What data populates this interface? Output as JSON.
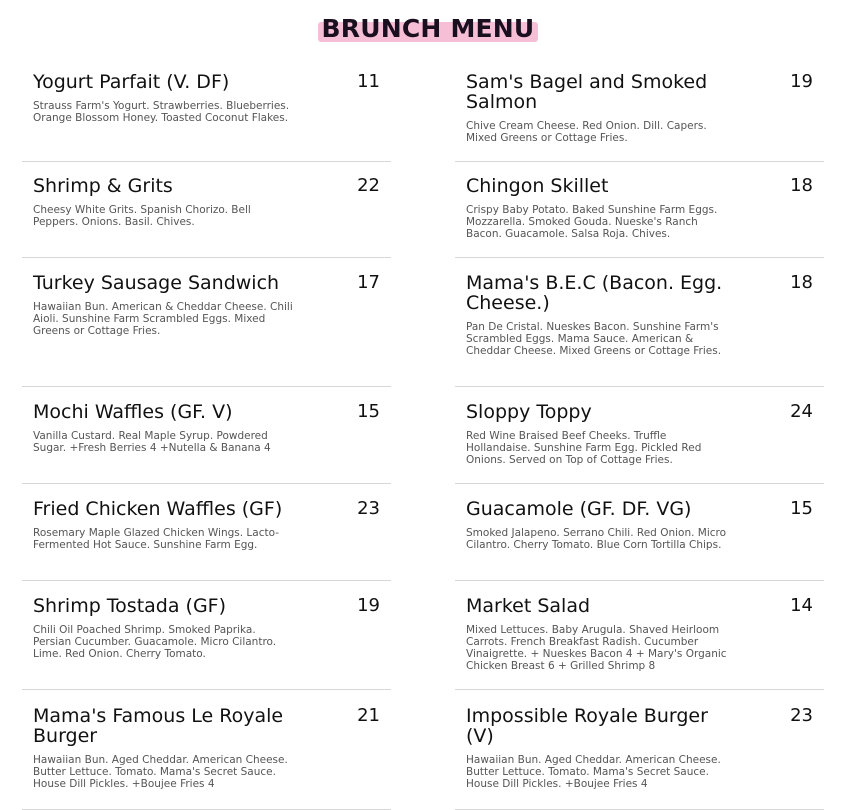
{
  "title": "BRUNCH MENU",
  "left": [
    {
      "name": "Yogurt Parfait (V. DF)",
      "price": "11",
      "desc": "Strauss Farm's Yogurt. Strawberries. Blueberries. Orange Blossom Honey. Toasted Coconut Flakes."
    },
    {
      "name": "Shrimp & Grits",
      "price": "22",
      "desc": "Cheesy White Grits. Spanish Chorizo. Bell Peppers. Onions. Basil. Chives."
    },
    {
      "name": "Turkey Sausage Sandwich",
      "price": "17",
      "desc": "Hawaiian Bun. American & Cheddar Cheese. Chili Aioli. Sunshine Farm Scrambled Eggs. Mixed Greens or Cottage Fries."
    },
    {
      "name": "Mochi Waffles (GF. V)",
      "price": "15",
      "desc": "Vanilla Custard. Real Maple Syrup. Powdered Sugar. +Fresh Berries 4 +Nutella & Banana 4"
    },
    {
      "name": "Fried Chicken Waffles (GF)",
      "price": "23",
      "desc": "Rosemary Maple Glazed Chicken Wings. Lacto-Fermented Hot Sauce. Sunshine Farm Egg."
    },
    {
      "name": "Shrimp Tostada (GF)",
      "price": "19",
      "desc": "Chili Oil Poached Shrimp. Smoked Paprika. Persian Cucumber. Guacamole. Micro Cilantro. Lime. Red Onion. Cherry Tomato."
    },
    {
      "name": "Mama's Famous Le Royale Burger",
      "price": "21",
      "desc": "Hawaiian Bun. Aged Cheddar. American Cheese. Butter Lettuce. Tomato. Mama's Secret Sauce. House Dill Pickles. +Boujee Fries 4"
    }
  ],
  "right": [
    {
      "name": "Sam's Bagel and Smoked Salmon",
      "price": "19",
      "desc": "Chive Cream Cheese. Red Onion. Dill. Capers. Mixed Greens or Cottage Fries."
    },
    {
      "name": "Chingon Skillet",
      "price": "18",
      "desc": "Crispy Baby Potato. Baked Sunshine Farm Eggs. Mozzarella. Smoked Gouda. Nueske's Ranch Bacon. Guacamole. Salsa Roja. Chives."
    },
    {
      "name": "Mama's B.E.C (Bacon. Egg. Cheese.)",
      "price": "18",
      "desc": "Pan De Cristal. Nueskes Bacon. Sunshine Farm's Scrambled Eggs. Mama Sauce. American & Cheddar Cheese. Mixed Greens or Cottage Fries."
    },
    {
      "name": "Sloppy Toppy",
      "price": "24",
      "desc": "Red Wine Braised Beef Cheeks. Truffle Hollandaise. Sunshine Farm Egg. Pickled Red Onions. Served on Top of Cottage Fries."
    },
    {
      "name": "Guacamole (GF. DF. VG)",
      "price": "15",
      "desc": "Smoked Jalapeno. Serrano Chili. Red Onion. Micro Cilantro. Cherry Tomato. Blue Corn Tortilla Chips."
    },
    {
      "name": "Market Salad",
      "price": "14",
      "desc": "Mixed Lettuces. Baby Arugula. Shaved Heirloom Carrots. French Breakfast Radish. Cucumber Vinaigrette. + Nueskes Bacon 4 + Mary's Organic Chicken Breast 6 + Grilled Shrimp 8"
    },
    {
      "name": "Impossible Royale Burger (V)",
      "price": "23",
      "desc": "Hawaiian Bun. Aged Cheddar. American Cheese. Butter Lettuce. Tomato. Mama's Secret Sauce. House Dill Pickles. +Boujee Fries 4"
    }
  ]
}
